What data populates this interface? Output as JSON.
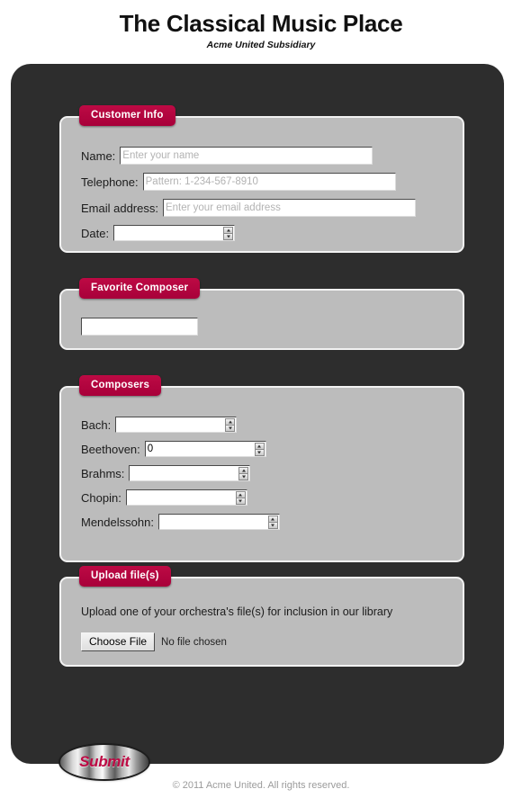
{
  "header": {
    "title": "The Classical Music Place",
    "subtitle": "Acme United Subsidiary"
  },
  "customer_info": {
    "legend": "Customer Info",
    "name": {
      "label": "Name:",
      "value": "",
      "placeholder": "Enter your name"
    },
    "telephone": {
      "label": "Telephone:",
      "value": "",
      "placeholder": "Pattern: 1-234-567-8910"
    },
    "email": {
      "label": "Email address:",
      "value": "",
      "placeholder": "Enter your email address"
    },
    "date": {
      "label": "Date:",
      "value": "",
      "placeholder": ""
    }
  },
  "favorite_composer": {
    "legend": "Favorite Composer",
    "input": {
      "value": "",
      "placeholder": ""
    }
  },
  "composers": {
    "legend": "Composers",
    "items": [
      {
        "label": "Bach:",
        "value": "",
        "placeholder": ""
      },
      {
        "label": "Beethoven:",
        "value": "0",
        "placeholder": ""
      },
      {
        "label": "Brahms:",
        "value": "",
        "placeholder": ""
      },
      {
        "label": "Chopin:",
        "value": "",
        "placeholder": ""
      },
      {
        "label": "Mendelssohn:",
        "value": "",
        "placeholder": ""
      }
    ]
  },
  "upload": {
    "legend": "Upload file(s)",
    "description": "Upload one of your orchestra's file(s) for inclusion in our library",
    "choose_label": "Choose File",
    "file_status": "No file chosen"
  },
  "submit": {
    "label": "Submit"
  },
  "footer": {
    "text": "© 2011 Acme United. All rights reserved."
  },
  "colors": {
    "accent": "#b4003c",
    "shell": "#2d2d2d",
    "panel": "#bcbcbc"
  }
}
